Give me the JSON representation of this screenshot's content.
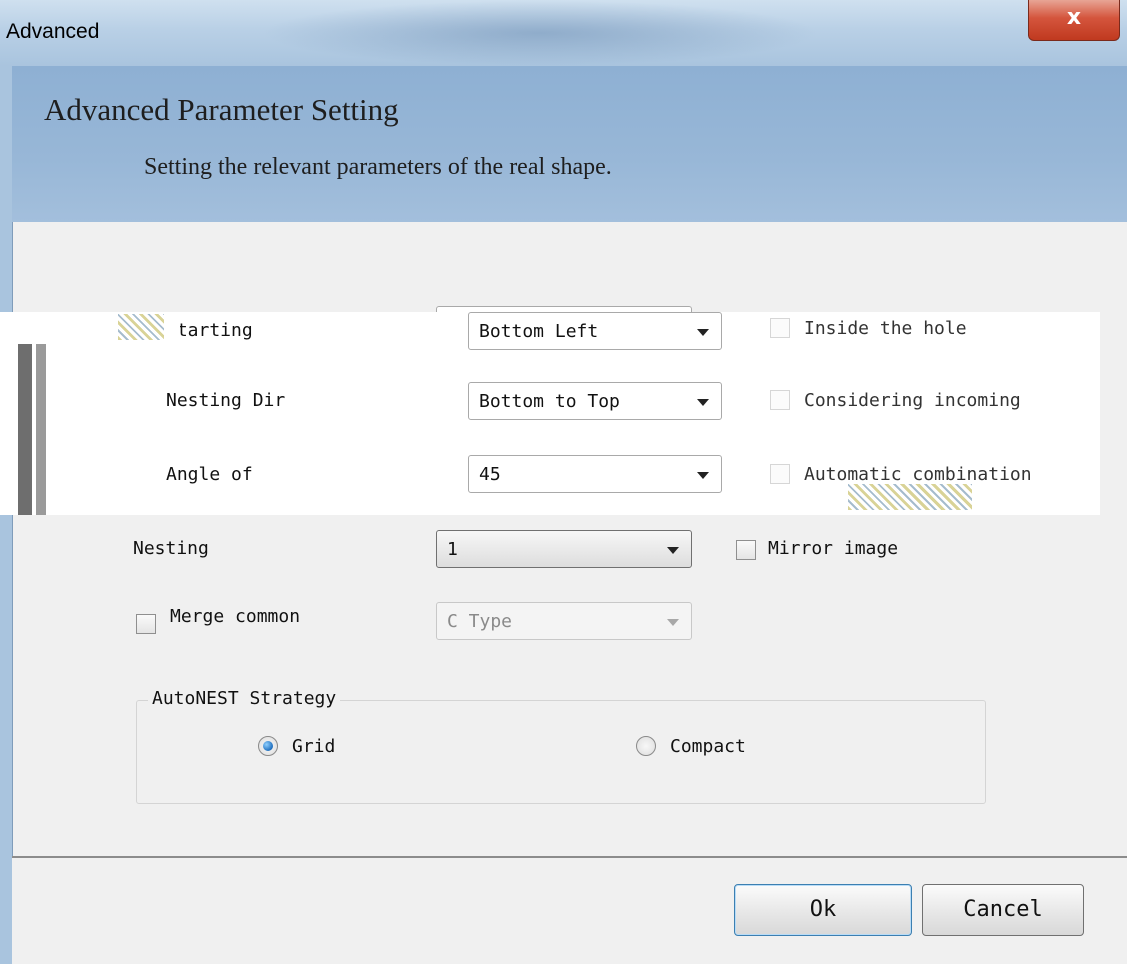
{
  "window": {
    "title": "Advanced",
    "close_glyph": "x"
  },
  "header": {
    "title": "Advanced Parameter Setting",
    "subtitle": "Setting the relevant parameters of the real shape."
  },
  "form": {
    "starting_label": "Starting",
    "starting_value": "Bottom Left",
    "nesting_dir_label": "Nesting Dir",
    "nesting_dir_value": "Bottom to Top",
    "angle_label": "Angle of",
    "angle_value": "45",
    "nesting_label": "Nesting",
    "nesting_value": "1",
    "merge_label": "Merge common",
    "merge_value": "C Type"
  },
  "options": {
    "inside_hole": "Inside the hole",
    "considering_incoming": "Considering incoming",
    "automatic_combination": "Automatic combination",
    "mirror_image": "Mirror image"
  },
  "strategy": {
    "legend": "AutoNEST Strategy",
    "grid_label": "Grid",
    "compact_label": "Compact",
    "selected": "Grid"
  },
  "buttons": {
    "ok": "Ok",
    "cancel": "Cancel"
  }
}
